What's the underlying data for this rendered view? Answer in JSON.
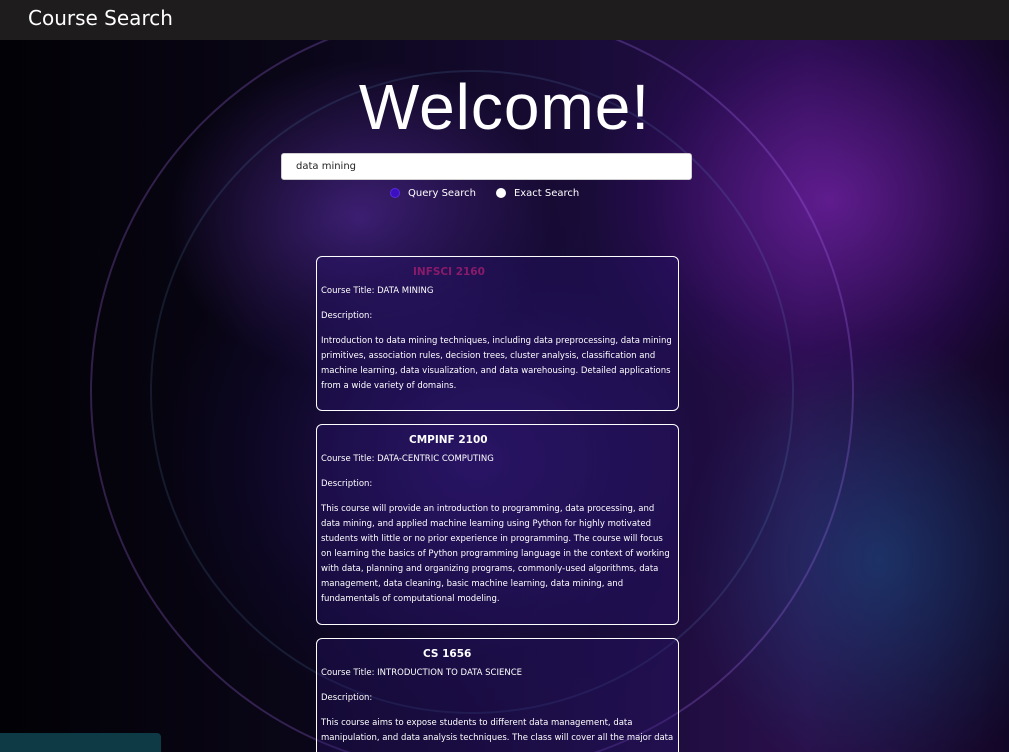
{
  "nav": {
    "brand": "Course Search"
  },
  "hero": {
    "title": "Welcome!"
  },
  "search": {
    "value": "data mining",
    "options": [
      {
        "label": "Query Search",
        "selected": true
      },
      {
        "label": "Exact Search",
        "selected": false
      }
    ]
  },
  "results": [
    {
      "code": "INFSCI 2160",
      "title": "Course Title: DATA MINING",
      "description_label": "Description:",
      "description": "Introduction to data mining techniques, including data preprocessing, data mining primitives, association rules, decision trees, cluster analysis, classification and machine learning, data visualization, and data warehousing. Detailed applications from a wide variety of domains."
    },
    {
      "code": "CMPINF 2100",
      "title": "Course Title: DATA-CENTRIC COMPUTING",
      "description_label": "Description:",
      "description": "This course will provide an introduction to programming, data processing, and data mining, and applied machine learning using Python for highly motivated students with little or no prior experience in programming. The course will focus on learning the basics of Python programming language in the context of working with data, planning and organizing programs, commonly-used algorithms, data management, data cleaning, basic machine learning, data mining, and fundamentals of computational modeling."
    },
    {
      "code": "CS 1656",
      "title": "Course Title: INTRODUCTION TO DATA SCIENCE",
      "description_label": "Description:",
      "description": "This course aims to expose students to different data management, data manipulation, and data analysis techniques. The class will cover all the major data"
    }
  ],
  "colors": {
    "navbar": "#1e1c1d",
    "code_accent_first": "#8a1a6a",
    "radio_selected": "#3b0fc2"
  }
}
